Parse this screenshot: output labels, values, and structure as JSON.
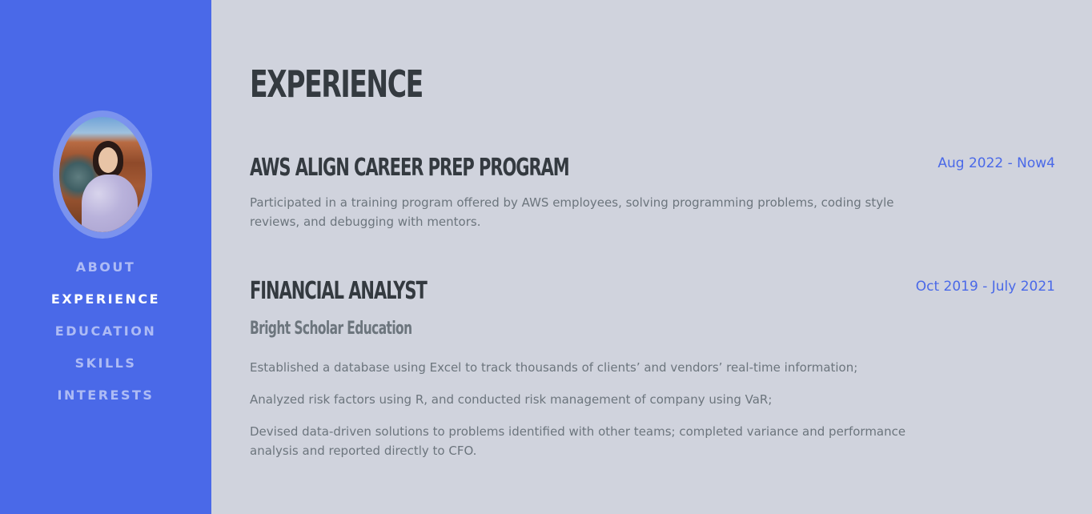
{
  "sidebar": {
    "avatar_alt": "Profile photo",
    "nav": [
      {
        "label": "ABOUT",
        "active": false
      },
      {
        "label": "EXPERIENCE",
        "active": true
      },
      {
        "label": "EDUCATION",
        "active": false
      },
      {
        "label": "SKILLS",
        "active": false
      },
      {
        "label": "INTERESTS",
        "active": false
      }
    ]
  },
  "colors": {
    "sidebar_bg": "#4a69e8",
    "main_bg": "#d0d3dd",
    "accent": "#4a69e8",
    "heading": "#343a40",
    "body_text": "#6c757d"
  },
  "main": {
    "title": "EXPERIENCE",
    "jobs": [
      {
        "title": "AWS ALIGN CAREER PREP PROGRAM",
        "date": "Aug 2022 - Now4",
        "descriptions": [
          "Participated in a training program offered by AWS employees, solving programming problems, coding style reviews, and debugging with mentors."
        ]
      },
      {
        "title": "FINANCIAL ANALYST",
        "company": "Bright Scholar Education",
        "date": "Oct 2019 - July 2021",
        "descriptions": [
          "Established a database using Excel to track thousands of clients’ and vendors’ real-time information;",
          "Analyzed risk factors using R, and conducted risk management of company using VaR;",
          "Devised data-driven solutions to problems identified with other teams; completed variance and performance analysis and reported directly to CFO."
        ]
      }
    ]
  }
}
